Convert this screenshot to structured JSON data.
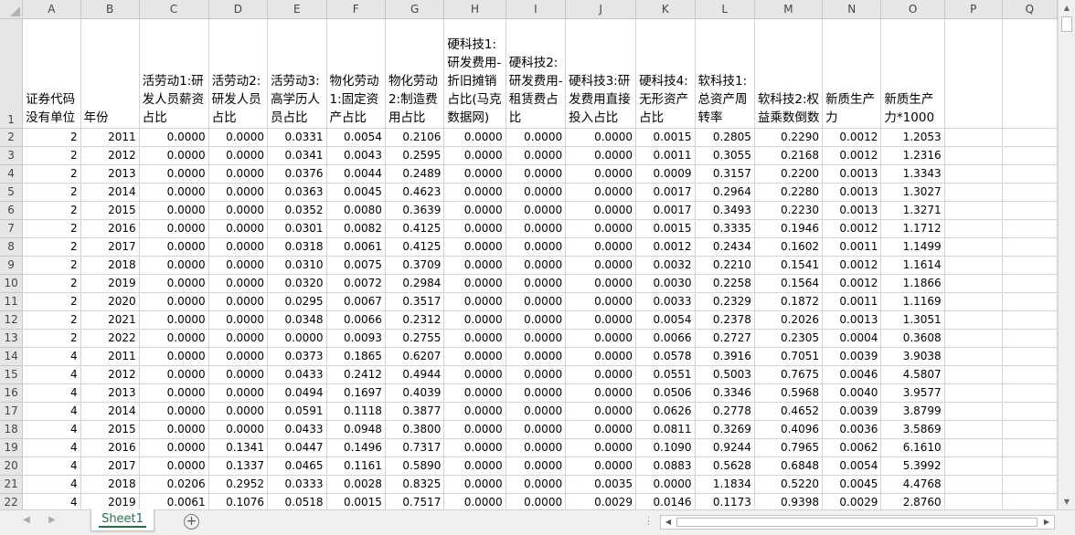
{
  "columns": [
    "A",
    "B",
    "C",
    "D",
    "E",
    "F",
    "G",
    "H",
    "I",
    "J",
    "K",
    "L",
    "M",
    "N",
    "O",
    "P",
    "Q"
  ],
  "header_row_number": "1",
  "headers": [
    "证券代码没有单位",
    "年份",
    "活劳动1:研发人员薪资占比",
    "活劳动2:研发人员占比",
    "活劳动3:高学历人员占比",
    "物化劳动1:固定资产占比",
    "物化劳动2:制造费用占比",
    "硬科技1:研发费用-折旧摊销占比(马克数据网)",
    "硬科技2:研发费用-租赁费占比",
    "硬科技3:研发费用直接投入占比",
    "硬科技4:无形资产占比",
    "软科技1:总资产周转率",
    "软科技2:权益乘数倒数",
    "新质生产力",
    "新质生产力*1000",
    "",
    ""
  ],
  "rows": [
    {
      "n": "2",
      "cells": [
        "2",
        "2011",
        "0.0000",
        "0.0000",
        "0.0331",
        "0.0054",
        "0.2106",
        "0.0000",
        "0.0000",
        "0.0000",
        "0.0015",
        "0.2805",
        "0.2290",
        "0.0012",
        "1.2053",
        "",
        ""
      ]
    },
    {
      "n": "3",
      "cells": [
        "2",
        "2012",
        "0.0000",
        "0.0000",
        "0.0341",
        "0.0043",
        "0.2595",
        "0.0000",
        "0.0000",
        "0.0000",
        "0.0011",
        "0.3055",
        "0.2168",
        "0.0012",
        "1.2316",
        "",
        ""
      ]
    },
    {
      "n": "4",
      "cells": [
        "2",
        "2013",
        "0.0000",
        "0.0000",
        "0.0376",
        "0.0044",
        "0.2489",
        "0.0000",
        "0.0000",
        "0.0000",
        "0.0009",
        "0.3157",
        "0.2200",
        "0.0013",
        "1.3343",
        "",
        ""
      ]
    },
    {
      "n": "5",
      "cells": [
        "2",
        "2014",
        "0.0000",
        "0.0000",
        "0.0363",
        "0.0045",
        "0.4623",
        "0.0000",
        "0.0000",
        "0.0000",
        "0.0017",
        "0.2964",
        "0.2280",
        "0.0013",
        "1.3027",
        "",
        ""
      ]
    },
    {
      "n": "6",
      "cells": [
        "2",
        "2015",
        "0.0000",
        "0.0000",
        "0.0352",
        "0.0080",
        "0.3639",
        "0.0000",
        "0.0000",
        "0.0000",
        "0.0017",
        "0.3493",
        "0.2230",
        "0.0013",
        "1.3271",
        "",
        ""
      ]
    },
    {
      "n": "7",
      "cells": [
        "2",
        "2016",
        "0.0000",
        "0.0000",
        "0.0301",
        "0.0082",
        "0.4125",
        "0.0000",
        "0.0000",
        "0.0000",
        "0.0015",
        "0.3335",
        "0.1946",
        "0.0012",
        "1.1712",
        "",
        ""
      ]
    },
    {
      "n": "8",
      "cells": [
        "2",
        "2017",
        "0.0000",
        "0.0000",
        "0.0318",
        "0.0061",
        "0.4125",
        "0.0000",
        "0.0000",
        "0.0000",
        "0.0012",
        "0.2434",
        "0.1602",
        "0.0011",
        "1.1499",
        "",
        ""
      ]
    },
    {
      "n": "9",
      "cells": [
        "2",
        "2018",
        "0.0000",
        "0.0000",
        "0.0310",
        "0.0075",
        "0.3709",
        "0.0000",
        "0.0000",
        "0.0000",
        "0.0032",
        "0.2210",
        "0.1541",
        "0.0012",
        "1.1614",
        "",
        ""
      ]
    },
    {
      "n": "10",
      "cells": [
        "2",
        "2019",
        "0.0000",
        "0.0000",
        "0.0320",
        "0.0072",
        "0.2984",
        "0.0000",
        "0.0000",
        "0.0000",
        "0.0030",
        "0.2258",
        "0.1564",
        "0.0012",
        "1.1866",
        "",
        ""
      ]
    },
    {
      "n": "11",
      "cells": [
        "2",
        "2020",
        "0.0000",
        "0.0000",
        "0.0295",
        "0.0067",
        "0.3517",
        "0.0000",
        "0.0000",
        "0.0000",
        "0.0033",
        "0.2329",
        "0.1872",
        "0.0011",
        "1.1169",
        "",
        ""
      ]
    },
    {
      "n": "12",
      "cells": [
        "2",
        "2021",
        "0.0000",
        "0.0000",
        "0.0348",
        "0.0066",
        "0.2312",
        "0.0000",
        "0.0000",
        "0.0000",
        "0.0054",
        "0.2378",
        "0.2026",
        "0.0013",
        "1.3051",
        "",
        ""
      ]
    },
    {
      "n": "13",
      "cells": [
        "2",
        "2022",
        "0.0000",
        "0.0000",
        "0.0000",
        "0.0093",
        "0.2755",
        "0.0000",
        "0.0000",
        "0.0000",
        "0.0066",
        "0.2727",
        "0.2305",
        "0.0004",
        "0.3608",
        "",
        ""
      ]
    },
    {
      "n": "14",
      "cells": [
        "4",
        "2011",
        "0.0000",
        "0.0000",
        "0.0373",
        "0.1865",
        "0.6207",
        "0.0000",
        "0.0000",
        "0.0000",
        "0.0578",
        "0.3916",
        "0.7051",
        "0.0039",
        "3.9038",
        "",
        ""
      ]
    },
    {
      "n": "15",
      "cells": [
        "4",
        "2012",
        "0.0000",
        "0.0000",
        "0.0433",
        "0.2412",
        "0.4944",
        "0.0000",
        "0.0000",
        "0.0000",
        "0.0551",
        "0.5003",
        "0.7675",
        "0.0046",
        "4.5807",
        "",
        ""
      ]
    },
    {
      "n": "16",
      "cells": [
        "4",
        "2013",
        "0.0000",
        "0.0000",
        "0.0494",
        "0.1697",
        "0.4039",
        "0.0000",
        "0.0000",
        "0.0000",
        "0.0506",
        "0.3346",
        "0.5968",
        "0.0040",
        "3.9577",
        "",
        ""
      ]
    },
    {
      "n": "17",
      "cells": [
        "4",
        "2014",
        "0.0000",
        "0.0000",
        "0.0591",
        "0.1118",
        "0.3877",
        "0.0000",
        "0.0000",
        "0.0000",
        "0.0626",
        "0.2778",
        "0.4652",
        "0.0039",
        "3.8799",
        "",
        ""
      ]
    },
    {
      "n": "18",
      "cells": [
        "4",
        "2015",
        "0.0000",
        "0.0000",
        "0.0433",
        "0.0948",
        "0.3800",
        "0.0000",
        "0.0000",
        "0.0000",
        "0.0811",
        "0.3269",
        "0.4096",
        "0.0036",
        "3.5869",
        "",
        ""
      ]
    },
    {
      "n": "19",
      "cells": [
        "4",
        "2016",
        "0.0000",
        "0.1341",
        "0.0447",
        "0.1496",
        "0.7317",
        "0.0000",
        "0.0000",
        "0.0000",
        "0.1090",
        "0.9244",
        "0.7965",
        "0.0062",
        "6.1610",
        "",
        ""
      ]
    },
    {
      "n": "20",
      "cells": [
        "4",
        "2017",
        "0.0000",
        "0.1337",
        "0.0465",
        "0.1161",
        "0.5890",
        "0.0000",
        "0.0000",
        "0.0000",
        "0.0883",
        "0.5628",
        "0.6848",
        "0.0054",
        "5.3992",
        "",
        ""
      ]
    },
    {
      "n": "21",
      "cells": [
        "4",
        "2018",
        "0.0206",
        "0.2952",
        "0.0333",
        "0.0028",
        "0.8325",
        "0.0000",
        "0.0000",
        "0.0035",
        "0.0000",
        "1.1834",
        "0.5220",
        "0.0045",
        "4.4768",
        "",
        ""
      ]
    },
    {
      "n": "22",
      "cells": [
        "4",
        "2019",
        "0.0061",
        "0.1076",
        "0.0518",
        "0.0015",
        "0.7517",
        "0.0000",
        "0.0000",
        "0.0029",
        "0.0146",
        "0.1173",
        "0.9398",
        "0.0029",
        "2.8760",
        "",
        ""
      ]
    }
  ],
  "sheet_tabs": [
    {
      "label": "Sheet1",
      "active": true
    }
  ],
  "add_sheet_symbol": "+",
  "colors": {
    "accent": "#217346",
    "header_bg": "#e6e6e6",
    "gridline": "#d4d4d4"
  }
}
